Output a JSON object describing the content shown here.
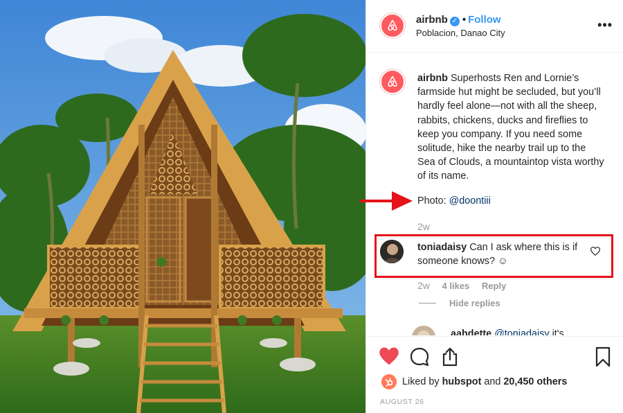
{
  "header": {
    "username": "airbnb",
    "verified_icon": "verified-badge-icon",
    "separator": "•",
    "follow_label": "Follow",
    "location": "Poblacion, Danao City",
    "more_icon": "more-options-icon",
    "more_glyph": "•••"
  },
  "caption": {
    "username": "airbnb",
    "text": "Superhosts Ren and Lornie’s farmside hut might be secluded, but you’ll hardly feel alone—not with all the sheep, rabbits, chickens, ducks and fireflies to keep you company. If you need some solitude, hike the nearby trail up to the Sea of Clouds, a mountaintop vista worthy of its name.",
    "photo_label": "Photo:",
    "photo_handle": "@doontiii",
    "time": "2w"
  },
  "comment": {
    "username": "toniadaisy",
    "text": "Can I ask where this is if someone knows? ☺",
    "time": "2w",
    "likes": "4 likes",
    "reply_label": "Reply",
    "hide_replies": "Hide replies"
  },
  "reply": {
    "username": "aahdette",
    "mention": "@toniadaisy",
    "text": "it's"
  },
  "actions": {
    "like_icon": "heart-icon",
    "comment_icon": "comment-icon",
    "share_icon": "share-icon",
    "save_icon": "bookmark-icon"
  },
  "likes": {
    "prefix": "Liked by",
    "user": "hubspot",
    "middle": "and",
    "count": "20,450 others"
  },
  "date": "AUGUST 26",
  "colors": {
    "brand": "#ff5a5f",
    "link": "#003569",
    "follow": "#3897f0",
    "annotation": "#e4121a",
    "like": "#ed4956"
  }
}
